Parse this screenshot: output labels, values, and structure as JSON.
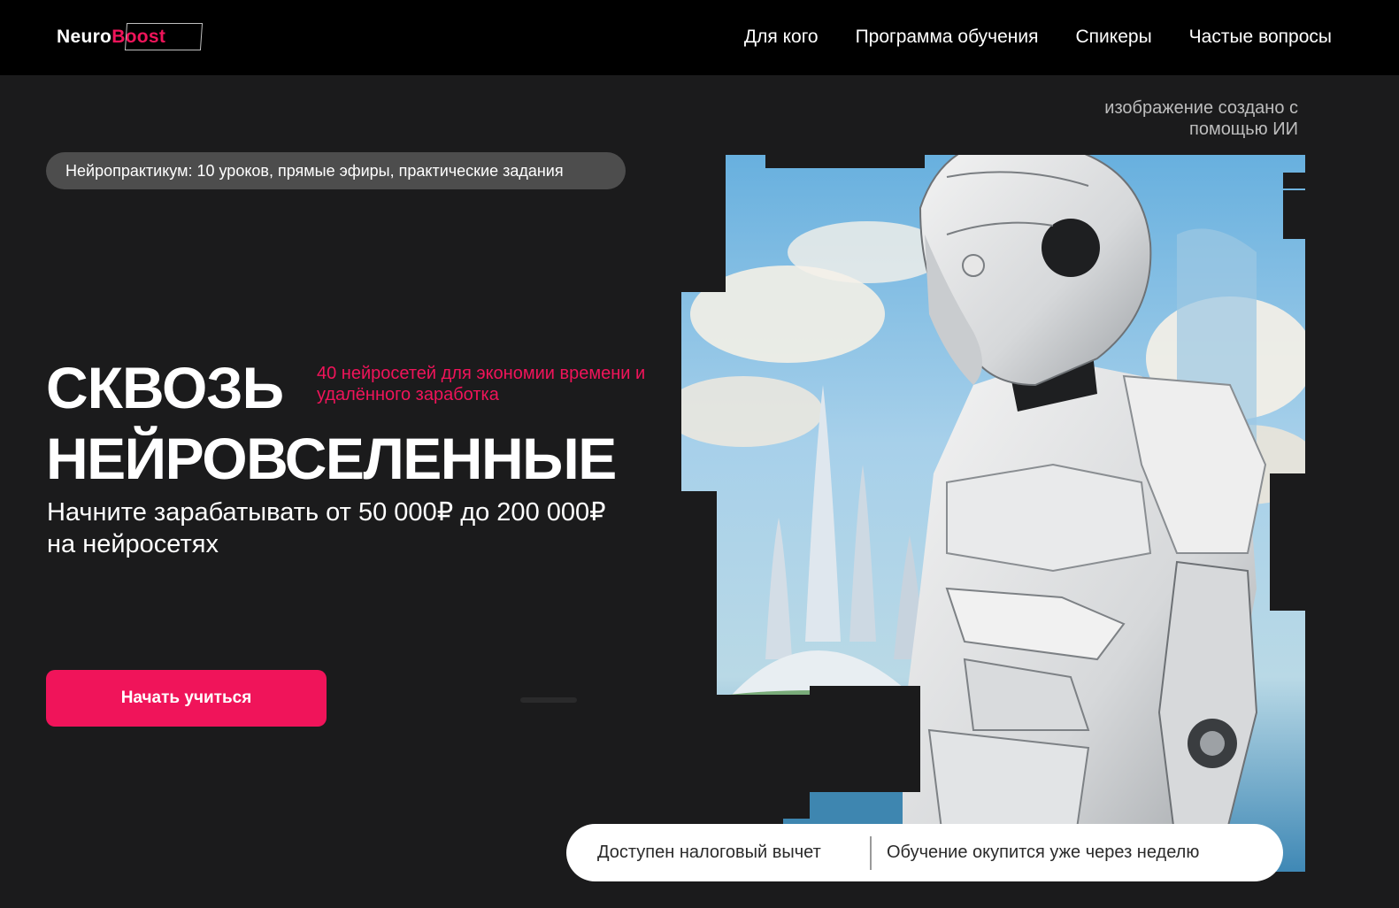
{
  "header": {
    "logo": {
      "part1": "Neuro",
      "part2": "Boost"
    },
    "nav": [
      "Для кого",
      "Программа обучения",
      "Спикеры",
      "Частые вопросы"
    ]
  },
  "hero": {
    "pill": "Нейропрактикум: 10 уроков, прямые эфиры, практические задания",
    "title_line1": "СКВОЗЬ",
    "title_line2": "НЕЙРОВСЕЛЕННЫЕ",
    "tagline": "40 нейросетей для экономии времени и удалённого заработка",
    "subtitle": "Начните зарабатывать от 50 000₽ до 200 000₽ на нейросетях",
    "cta": "Начать учиться",
    "ai_note": "изображение создано с помощью ИИ"
  },
  "badges": [
    "Доступен налоговый вычет",
    "Обучение окупится уже через неделю"
  ],
  "colors": {
    "accent": "#f0145a",
    "background": "#1b1b1c",
    "header": "#000000",
    "pill": "#4d4d4d"
  },
  "icons": [
    "robot-illustration"
  ]
}
